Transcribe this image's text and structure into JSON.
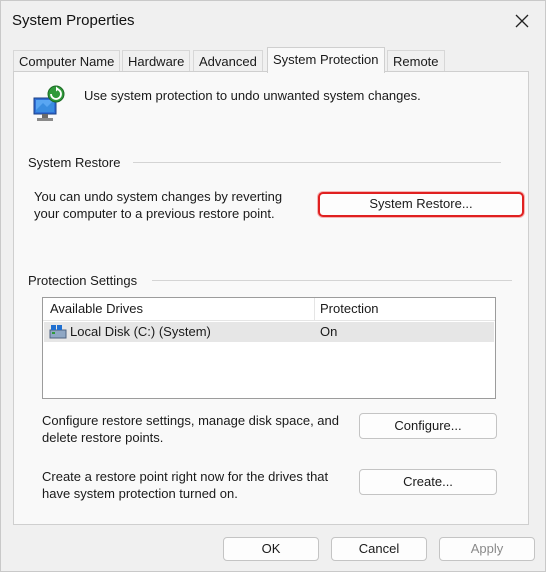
{
  "window": {
    "title": "System Properties",
    "close_icon": "close-icon"
  },
  "tabs": [
    {
      "label": "Computer Name"
    },
    {
      "label": "Hardware"
    },
    {
      "label": "Advanced"
    },
    {
      "label": "System Protection",
      "active": true
    },
    {
      "label": "Remote"
    }
  ],
  "header": {
    "icon": "system-protection-icon",
    "text": "Use system protection to undo unwanted system changes."
  },
  "system_restore": {
    "group_label": "System Restore",
    "description_line1": "You can undo system changes by reverting",
    "description_line2": "your computer to a previous restore point.",
    "button_label": "System Restore..."
  },
  "protection_settings": {
    "group_label": "Protection Settings",
    "columns": [
      "Available Drives",
      "Protection"
    ],
    "rows": [
      {
        "drive": "Local Disk (C:) (System)",
        "protection": "On",
        "icon": "disk-drive-icon"
      }
    ],
    "configure_text_line1": "Configure restore settings, manage disk space, and",
    "configure_text_line2": "delete restore points.",
    "configure_button": "Configure...",
    "create_text_line1": "Create a restore point right now for the drives that",
    "create_text_line2": "have system protection turned on.",
    "create_button": "Create..."
  },
  "footer": {
    "ok": "OK",
    "cancel": "Cancel",
    "apply": "Apply"
  },
  "colors": {
    "highlight_border": "#e02020",
    "dialog_bg": "#f0f0f0",
    "panel_bg": "#f9f9f9"
  }
}
